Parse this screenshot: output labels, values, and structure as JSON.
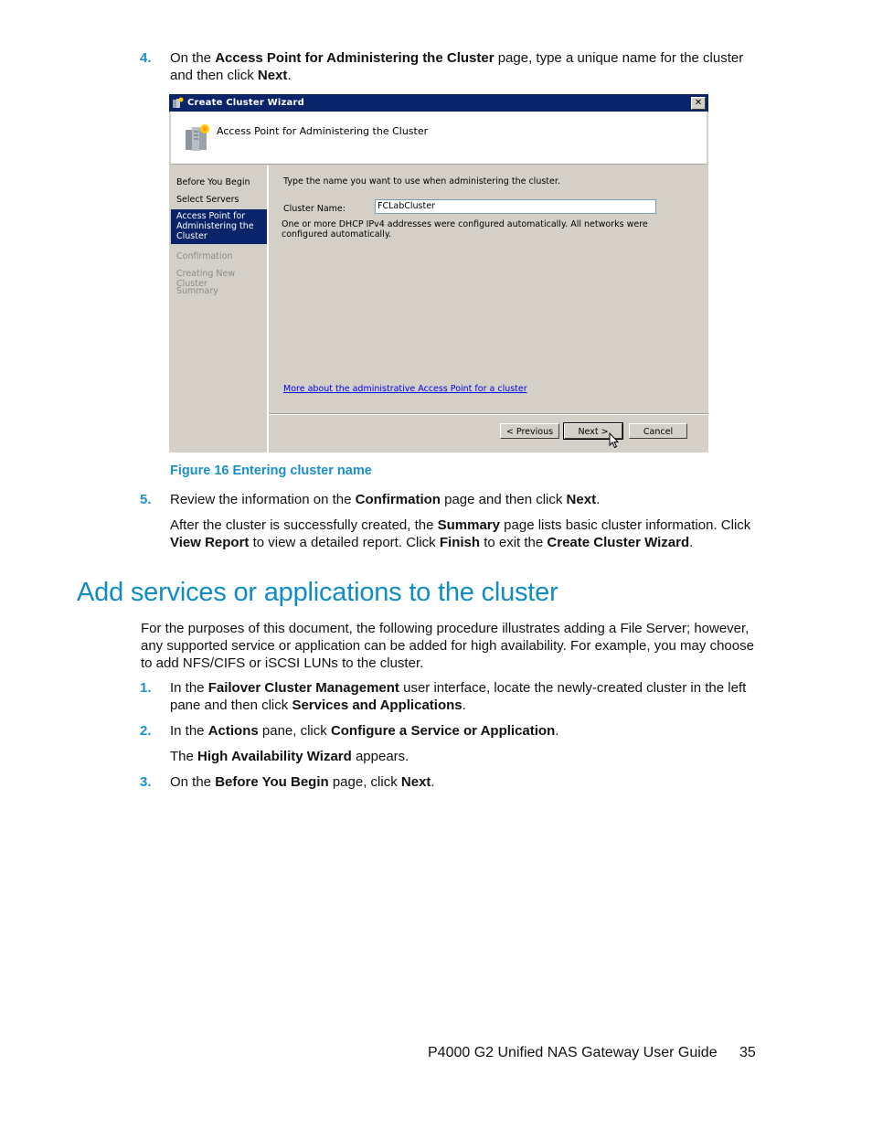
{
  "steps_top": [
    {
      "number": "4.",
      "segments": [
        {
          "text": "On the ",
          "bold": false
        },
        {
          "text": "Access Point for Administering the Cluster",
          "bold": true
        },
        {
          "text": " page, type a unique name for the cluster and then click ",
          "bold": false
        },
        {
          "text": "Next",
          "bold": true
        },
        {
          "text": ".",
          "bold": false
        }
      ]
    }
  ],
  "wizard": {
    "title": "Create Cluster Wizard",
    "close_glyph": "✕",
    "header_title": "Access Point for Administering the Cluster",
    "nav_items": [
      {
        "label": "Before You Begin",
        "state": "done"
      },
      {
        "label": "Select Servers",
        "state": "done"
      },
      {
        "label": "Access Point for Administering the Cluster",
        "state": "active"
      },
      {
        "label": "Confirmation",
        "state": "future"
      },
      {
        "label": "Creating New Cluster",
        "state": "future"
      },
      {
        "label": "Summary",
        "state": "future"
      }
    ],
    "instruction": "Type the name you want to use when administering the cluster.",
    "cluster_name_label": "Cluster Name:",
    "cluster_name_value": "FCLabCluster",
    "dhcp_note": "One or more DHCP IPv4 addresses were configured automatically.  All networks were configured automatically.",
    "help_link": "More about the administrative Access Point for a cluster",
    "buttons": {
      "previous": "< Previous",
      "next": "Next >",
      "cancel": "Cancel"
    }
  },
  "figure_caption": "Figure 16 Entering cluster name",
  "step5": {
    "number": "5.",
    "segments": [
      {
        "text": "Review the information on the ",
        "bold": false
      },
      {
        "text": "Confirmation",
        "bold": true
      },
      {
        "text": " page and then click ",
        "bold": false
      },
      {
        "text": "Next",
        "bold": true
      },
      {
        "text": ".",
        "bold": false
      }
    ],
    "followup": [
      {
        "text": "After the cluster is successfully created, the ",
        "bold": false
      },
      {
        "text": "Summary",
        "bold": true
      },
      {
        "text": " page lists basic cluster information. Click ",
        "bold": false
      },
      {
        "text": "View Report",
        "bold": true
      },
      {
        "text": " to view a detailed report. Click ",
        "bold": false
      },
      {
        "text": "Finish",
        "bold": true
      },
      {
        "text": " to exit the ",
        "bold": false
      },
      {
        "text": "Create Cluster Wizard",
        "bold": true
      },
      {
        "text": ".",
        "bold": false
      }
    ]
  },
  "section": {
    "heading": "Add services or applications to the cluster",
    "intro": "For the purposes of this document, the following procedure illustrates adding a File Server; however, any supported service or application can be added for high availability. For example, you may choose to add NFS/CIFS or iSCSI LUNs to the cluster.",
    "steps": [
      {
        "number": "1.",
        "segments": [
          {
            "text": "In the ",
            "bold": false
          },
          {
            "text": "Failover Cluster Management",
            "bold": true
          },
          {
            "text": " user interface, locate the newly-created cluster in the left pane and then click ",
            "bold": false
          },
          {
            "text": "Services and Applications",
            "bold": true
          },
          {
            "text": ".",
            "bold": false
          }
        ]
      },
      {
        "number": "2.",
        "segments": [
          {
            "text": "In the ",
            "bold": false
          },
          {
            "text": "Actions",
            "bold": true
          },
          {
            "text": " pane, click ",
            "bold": false
          },
          {
            "text": "Configure a Service or Application",
            "bold": true
          },
          {
            "text": ".",
            "bold": false
          }
        ],
        "followup": [
          {
            "text": "The ",
            "bold": false
          },
          {
            "text": "High Availability Wizard",
            "bold": true
          },
          {
            "text": " appears.",
            "bold": false
          }
        ]
      },
      {
        "number": "3.",
        "segments": [
          {
            "text": "On the ",
            "bold": false
          },
          {
            "text": "Before You Begin",
            "bold": true
          },
          {
            "text": " page, click ",
            "bold": false
          },
          {
            "text": "Next",
            "bold": true
          },
          {
            "text": ".",
            "bold": false
          }
        ]
      }
    ]
  },
  "footer": {
    "guide_title": "P4000 G2 Unified NAS Gateway User Guide",
    "page_number": "35"
  },
  "colors": {
    "accent_blue": "#1a8fc9",
    "titlebar_navy": "#0a246a",
    "dialog_gray": "#d4d0c8",
    "link_blue": "#0000ee"
  }
}
